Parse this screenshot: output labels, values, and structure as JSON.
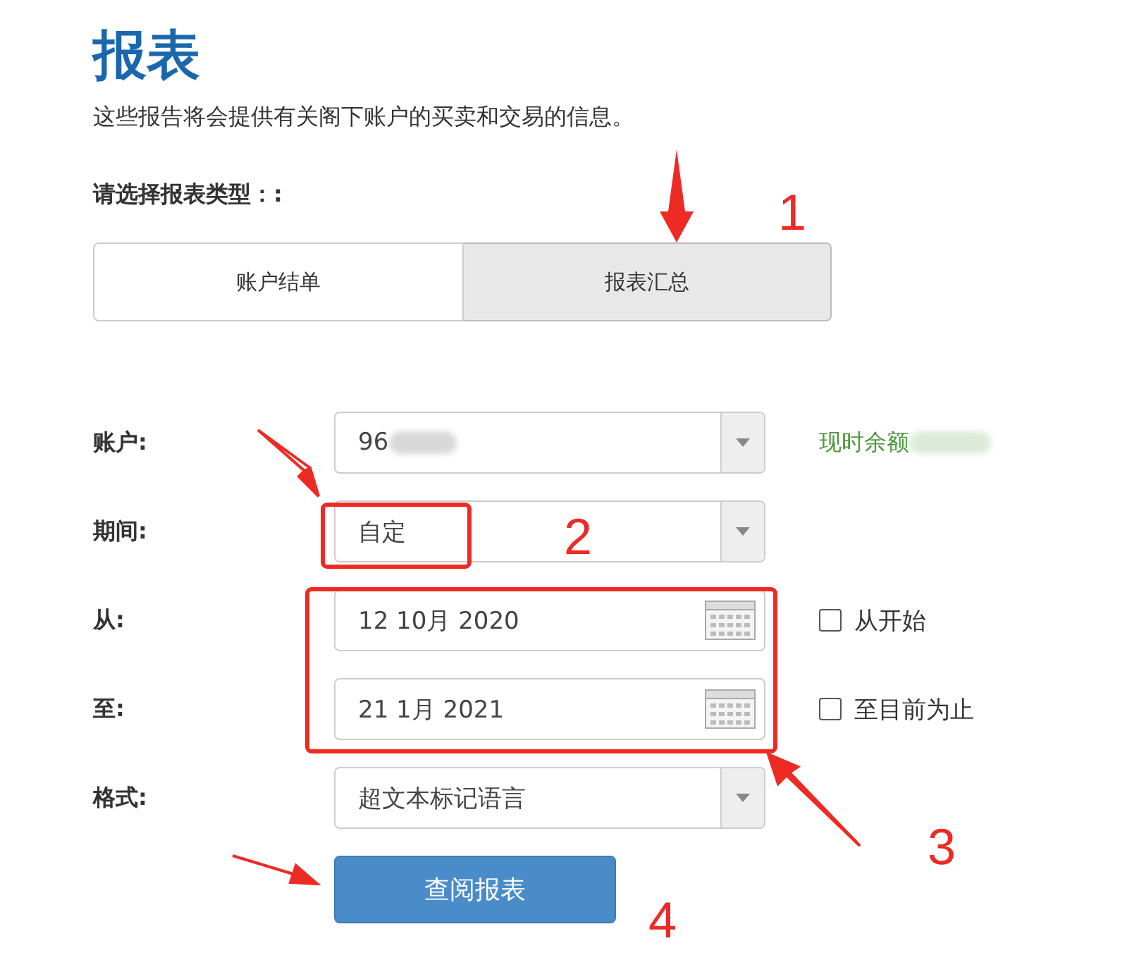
{
  "title": "报表",
  "description": "这些报告将会提供有关阁下账户的买卖和交易的信息。",
  "type_prompt": "请选择报表类型：:",
  "tabs": [
    {
      "label": "账户结单",
      "selected": false
    },
    {
      "label": "报表汇总",
      "selected": true
    }
  ],
  "fields": [
    {
      "kind": "select",
      "label": "账户:",
      "value": "96",
      "redacted": true,
      "side_text": "现时余额",
      "side_redacted": true
    },
    {
      "kind": "select",
      "label": "期间:",
      "value": "自定"
    },
    {
      "kind": "date",
      "label": "从:",
      "value": "12 10月 2020",
      "checkbox": {
        "label": "从开始",
        "checked": false
      }
    },
    {
      "kind": "date",
      "label": "至:",
      "value": "21 1月 2021",
      "checkbox": {
        "label": "至目前为止",
        "checked": false
      }
    },
    {
      "kind": "select",
      "label": "格式:",
      "value": "超文本标记语言"
    }
  ],
  "submit": "查阅报表",
  "annotations": [
    "1",
    "2",
    "3",
    "4"
  ]
}
